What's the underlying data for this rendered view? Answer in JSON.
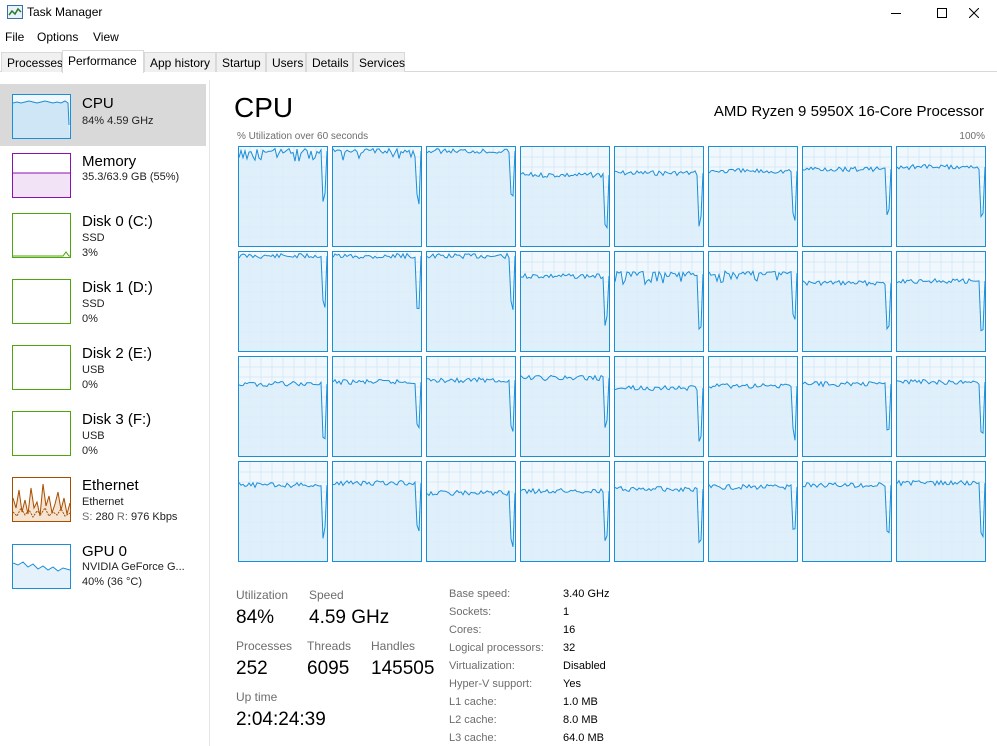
{
  "window": {
    "title": "Task Manager"
  },
  "menu": [
    "File",
    "Options",
    "View"
  ],
  "tabs": [
    "Processes",
    "Performance",
    "App history",
    "Startup",
    "Users",
    "Details",
    "Services"
  ],
  "active_tab": "Performance",
  "colors": {
    "cpu": "#1a8ed8",
    "memory": "#8b12ae",
    "disk": "#4da60c",
    "ethernet": "#a74f01",
    "gpu": "#1a8ed8"
  },
  "sidebar": [
    {
      "name": "CPU",
      "line1": "84%  4.59 GHz"
    },
    {
      "name": "Memory",
      "line1": "35.3/63.9 GB (55%)"
    },
    {
      "name": "Disk 0 (C:)",
      "line1": "SSD",
      "line2": "3%"
    },
    {
      "name": "Disk 1 (D:)",
      "line1": "SSD",
      "line2": "0%"
    },
    {
      "name": "Disk 2 (E:)",
      "line1": "USB",
      "line2": "0%"
    },
    {
      "name": "Disk 3 (F:)",
      "line1": "USB",
      "line2": "0%"
    },
    {
      "name": "Ethernet",
      "line1": "Ethernet",
      "send_label": "S:",
      "send_value": "280",
      "recv_label": "R:",
      "recv_value": "976 Kbps"
    },
    {
      "name": "GPU 0",
      "line1": "NVIDIA GeForce G...",
      "line2": "40% (36 °C)"
    }
  ],
  "main": {
    "title": "CPU",
    "model": "AMD Ryzen 9 5950X 16-Core Processor",
    "graph_caption": "% Utilization over 60 seconds",
    "graph_max": "100%",
    "logical_processor_count": 32,
    "stats": {
      "utilization_label": "Utilization",
      "utilization": "84%",
      "speed_label": "Speed",
      "speed": "4.59 GHz",
      "processes_label": "Processes",
      "processes": "252",
      "threads_label": "Threads",
      "threads": "6095",
      "handles_label": "Handles",
      "handles": "145505",
      "uptime_label": "Up time",
      "uptime": "2:04:24:39"
    },
    "specs": [
      {
        "label": "Base speed:",
        "value": "3.40 GHz"
      },
      {
        "label": "Sockets:",
        "value": "1"
      },
      {
        "label": "Cores:",
        "value": "16"
      },
      {
        "label": "Logical processors:",
        "value": "32"
      },
      {
        "label": "Virtualization:",
        "value": "Disabled"
      },
      {
        "label": "Hyper-V support:",
        "value": "Yes"
      },
      {
        "label": "L1 cache:",
        "value": "1.0 MB"
      },
      {
        "label": "L2 cache:",
        "value": "8.0 MB"
      },
      {
        "label": "L3 cache:",
        "value": "64.0 MB"
      }
    ]
  }
}
